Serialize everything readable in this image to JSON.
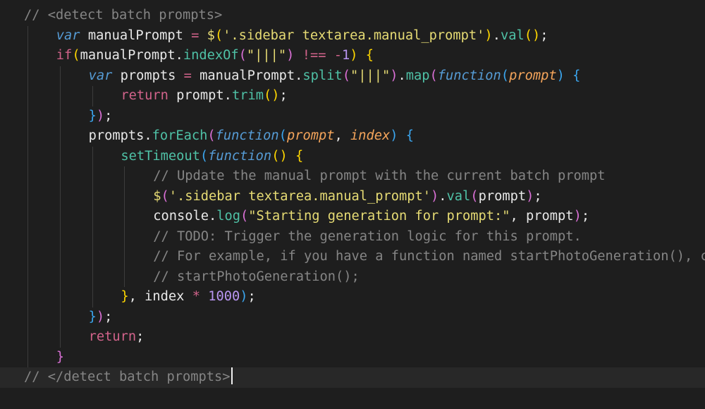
{
  "editor": {
    "language": "javascript",
    "colors": {
      "background": "#1e1e1e",
      "current_line": "#282828",
      "comment": "#858585",
      "keyword": "#569cd6",
      "control": "#d2638b",
      "function": "#4fc1a6",
      "string": "#e6db74",
      "number": "#b996f2",
      "parameter": "#f5a55b",
      "bracket_1": "#ffd700",
      "bracket_2": "#da70d6",
      "bracket_3": "#3ba6ef"
    },
    "lines": [
      {
        "indent": 0,
        "tokens": [
          {
            "k": "com",
            "t": "// <detect batch prompts>"
          }
        ]
      },
      {
        "indent": 1,
        "tokens": [
          {
            "k": "kw",
            "t": "var"
          },
          {
            "k": "var",
            "t": " manualPrompt "
          },
          {
            "k": "op",
            "t": "="
          },
          {
            "k": "var",
            "t": " "
          },
          {
            "k": "dol",
            "t": "$"
          },
          {
            "k": "p1",
            "t": "("
          },
          {
            "k": "str",
            "t": "'.sidebar textarea.manual_prompt'"
          },
          {
            "k": "p1",
            "t": ")"
          },
          {
            "k": "punc",
            "t": "."
          },
          {
            "k": "fn",
            "t": "val"
          },
          {
            "k": "p1",
            "t": "()"
          },
          {
            "k": "punc",
            "t": ";"
          }
        ]
      },
      {
        "indent": 1,
        "tokens": [
          {
            "k": "ctrl",
            "t": "if"
          },
          {
            "k": "p1",
            "t": "("
          },
          {
            "k": "var",
            "t": "manualPrompt"
          },
          {
            "k": "punc",
            "t": "."
          },
          {
            "k": "fn",
            "t": "indexOf"
          },
          {
            "k": "p2",
            "t": "("
          },
          {
            "k": "str",
            "t": "\"|||\""
          },
          {
            "k": "p2",
            "t": ")"
          },
          {
            "k": "var",
            "t": " "
          },
          {
            "k": "op",
            "t": "!=="
          },
          {
            "k": "var",
            "t": " "
          },
          {
            "k": "op",
            "t": "-"
          },
          {
            "k": "num",
            "t": "1"
          },
          {
            "k": "p1",
            "t": ")"
          },
          {
            "k": "var",
            "t": " "
          },
          {
            "k": "p1",
            "t": "{"
          }
        ]
      },
      {
        "indent": 2,
        "tokens": [
          {
            "k": "kw",
            "t": "var"
          },
          {
            "k": "var",
            "t": " prompts "
          },
          {
            "k": "op",
            "t": "="
          },
          {
            "k": "var",
            "t": " manualPrompt"
          },
          {
            "k": "punc",
            "t": "."
          },
          {
            "k": "fn",
            "t": "split"
          },
          {
            "k": "p2",
            "t": "("
          },
          {
            "k": "str",
            "t": "\"|||\""
          },
          {
            "k": "p2",
            "t": ")"
          },
          {
            "k": "punc",
            "t": "."
          },
          {
            "k": "fn",
            "t": "map"
          },
          {
            "k": "p2",
            "t": "("
          },
          {
            "k": "kw",
            "t": "function"
          },
          {
            "k": "p3",
            "t": "("
          },
          {
            "k": "par",
            "t": "prompt"
          },
          {
            "k": "p3",
            "t": ")"
          },
          {
            "k": "var",
            "t": " "
          },
          {
            "k": "p3",
            "t": "{"
          }
        ]
      },
      {
        "indent": 3,
        "tokens": [
          {
            "k": "ctrl",
            "t": "return"
          },
          {
            "k": "var",
            "t": " prompt"
          },
          {
            "k": "punc",
            "t": "."
          },
          {
            "k": "fn",
            "t": "trim"
          },
          {
            "k": "p1",
            "t": "()"
          },
          {
            "k": "punc",
            "t": ";"
          }
        ]
      },
      {
        "indent": 2,
        "tokens": [
          {
            "k": "p3",
            "t": "}"
          },
          {
            "k": "p2",
            "t": ")"
          },
          {
            "k": "punc",
            "t": ";"
          }
        ]
      },
      {
        "indent": 2,
        "tokens": [
          {
            "k": "var",
            "t": "prompts"
          },
          {
            "k": "punc",
            "t": "."
          },
          {
            "k": "fn",
            "t": "forEach"
          },
          {
            "k": "p2",
            "t": "("
          },
          {
            "k": "kw",
            "t": "function"
          },
          {
            "k": "p3",
            "t": "("
          },
          {
            "k": "par",
            "t": "prompt"
          },
          {
            "k": "punc",
            "t": ", "
          },
          {
            "k": "par",
            "t": "index"
          },
          {
            "k": "p3",
            "t": ")"
          },
          {
            "k": "var",
            "t": " "
          },
          {
            "k": "p3",
            "t": "{"
          }
        ]
      },
      {
        "indent": 3,
        "tokens": [
          {
            "k": "fn",
            "t": "setTimeout"
          },
          {
            "k": "p3",
            "t": "("
          },
          {
            "k": "kw",
            "t": "function"
          },
          {
            "k": "p1",
            "t": "()"
          },
          {
            "k": "var",
            "t": " "
          },
          {
            "k": "p1",
            "t": "{"
          }
        ]
      },
      {
        "indent": 4,
        "tokens": [
          {
            "k": "com",
            "t": "// Update the manual prompt with the current batch prompt"
          }
        ]
      },
      {
        "indent": 4,
        "tokens": [
          {
            "k": "dol",
            "t": "$"
          },
          {
            "k": "p2",
            "t": "("
          },
          {
            "k": "str",
            "t": "'.sidebar textarea.manual_prompt'"
          },
          {
            "k": "p2",
            "t": ")"
          },
          {
            "k": "punc",
            "t": "."
          },
          {
            "k": "fn",
            "t": "val"
          },
          {
            "k": "p2",
            "t": "("
          },
          {
            "k": "var",
            "t": "prompt"
          },
          {
            "k": "p2",
            "t": ")"
          },
          {
            "k": "punc",
            "t": ";"
          }
        ]
      },
      {
        "indent": 4,
        "tokens": [
          {
            "k": "var",
            "t": "console"
          },
          {
            "k": "punc",
            "t": "."
          },
          {
            "k": "fn",
            "t": "log"
          },
          {
            "k": "p2",
            "t": "("
          },
          {
            "k": "str",
            "t": "\"Starting generation for prompt:\""
          },
          {
            "k": "punc",
            "t": ", "
          },
          {
            "k": "var",
            "t": "prompt"
          },
          {
            "k": "p2",
            "t": ")"
          },
          {
            "k": "punc",
            "t": ";"
          }
        ]
      },
      {
        "indent": 4,
        "tokens": [
          {
            "k": "com",
            "t": "// TODO: Trigger the generation logic for this prompt."
          }
        ]
      },
      {
        "indent": 4,
        "tokens": [
          {
            "k": "com",
            "t": "// For example, if you have a function named startPhotoGeneration(), call it here"
          }
        ]
      },
      {
        "indent": 4,
        "tokens": [
          {
            "k": "com",
            "t": "// startPhotoGeneration();"
          }
        ]
      },
      {
        "indent": 3,
        "tokens": [
          {
            "k": "p1",
            "t": "}"
          },
          {
            "k": "punc",
            "t": ", "
          },
          {
            "k": "var",
            "t": "index "
          },
          {
            "k": "op",
            "t": "*"
          },
          {
            "k": "var",
            "t": " "
          },
          {
            "k": "num",
            "t": "1000"
          },
          {
            "k": "p3",
            "t": ")"
          },
          {
            "k": "punc",
            "t": ";"
          }
        ]
      },
      {
        "indent": 2,
        "tokens": [
          {
            "k": "p3",
            "t": "}"
          },
          {
            "k": "p2",
            "t": ")"
          },
          {
            "k": "punc",
            "t": ";"
          }
        ]
      },
      {
        "indent": 2,
        "tokens": [
          {
            "k": "ctrl",
            "t": "return"
          },
          {
            "k": "punc",
            "t": ";"
          }
        ]
      },
      {
        "indent": 1,
        "tokens": [
          {
            "k": "p2",
            "t": "}"
          }
        ]
      },
      {
        "indent": 0,
        "current": true,
        "cursor": true,
        "tokens": [
          {
            "k": "com",
            "t": "// </detect batch prompts>"
          }
        ]
      }
    ]
  }
}
